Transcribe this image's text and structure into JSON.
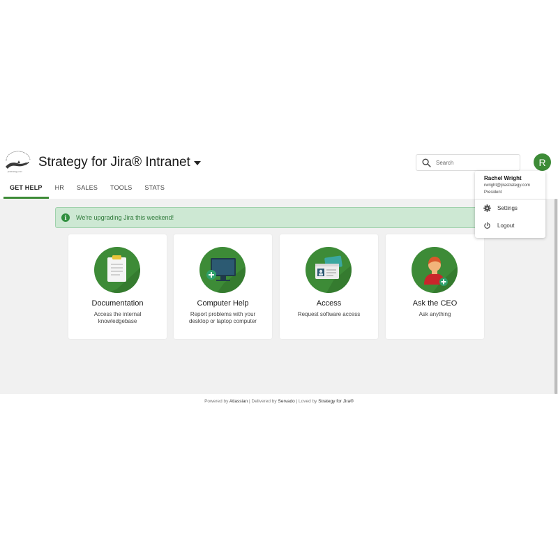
{
  "header": {
    "title": "Strategy for Jira® Intranet",
    "logo_text": "jirastrategy.com",
    "search_placeholder": "Search",
    "avatar_initial": "R"
  },
  "tabs": [
    {
      "label": "GET HELP",
      "active": true
    },
    {
      "label": "HR",
      "active": false
    },
    {
      "label": "SALES",
      "active": false
    },
    {
      "label": "TOOLS",
      "active": false
    },
    {
      "label": "STATS",
      "active": false
    }
  ],
  "banner": {
    "icon": "info-icon",
    "text": "We're upgrading Jira this weekend!"
  },
  "cards": [
    {
      "title": "Documentation",
      "description": "Access the internal knowledgebase",
      "icon": "clipboard-icon"
    },
    {
      "title": "Computer Help",
      "description": "Report problems with your desktop or laptop computer",
      "icon": "computer-icon"
    },
    {
      "title": "Access",
      "description": "Request software access",
      "icon": "id-card-icon"
    },
    {
      "title": "Ask the CEO",
      "description": "Ask anything",
      "icon": "person-icon"
    }
  ],
  "footer": {
    "powered_prefix": "Powered by",
    "powered": "Atlassian",
    "delivered_prefix": "Delivered by",
    "delivered": "Servado",
    "loved_prefix": "Loved by",
    "loved": "Strategy for Jira®"
  },
  "user_menu": {
    "name": "Rachel Wright",
    "email": "rwright@jirastrategy.com",
    "role": "President",
    "items": [
      {
        "label": "Settings",
        "icon": "gear-icon"
      },
      {
        "label": "Logout",
        "icon": "power-icon"
      }
    ]
  },
  "colors": {
    "accent": "#3d8b37",
    "banner_bg": "#cde8d3",
    "banner_text": "#2f7a3b",
    "page_bg": "#f1f1f1"
  }
}
